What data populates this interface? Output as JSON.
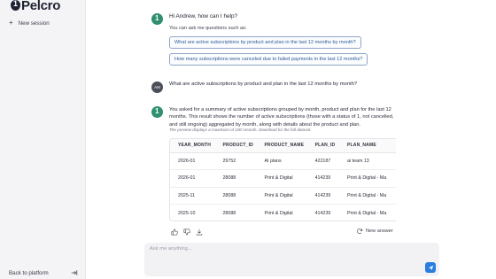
{
  "brand": {
    "name": "Pelcro"
  },
  "sidebar": {
    "new_session_label": "New session",
    "back_label": "Back to platform"
  },
  "chat": {
    "greeting": "Hi Andrew, how can I help?",
    "intro": "You can ask me questions such as:",
    "suggestions": [
      "What are active subscriptions by product and plan in the last 12 months by month?",
      "How many subscriptions were canceled due to failed payments in the last 12 months?"
    ],
    "user_initials": "AM",
    "user_question": "What are active subscriptions by product and plan in the last 12 months by month?",
    "answer": "You asked for a summary of active subscriptions grouped by month, product and plan for the last 12 months. This result shows the number of active subscriptions (those with a status of 1, not cancelled, and still ongoing) aggregated by month, along with details about the product and plan.",
    "preview_note": "The preview displays a maximum of 100 records. Download for the full dataset."
  },
  "table": {
    "headers": [
      "YEAR_MONTH",
      "PRODUCT_ID",
      "PRODUCT_NAME",
      "PLAN_ID",
      "PLAN_NAME"
    ],
    "rows": [
      [
        "2026-01",
        "29752",
        "AI plans",
        "422187",
        "ai team 13"
      ],
      [
        "2026-01",
        "28088",
        "Print & Digital",
        "414239",
        "Print & Digital - Ma"
      ],
      [
        "2025-11",
        "28088",
        "Print & Digital",
        "414239",
        "Print & Digital - Ma"
      ],
      [
        "2025-10",
        "28088",
        "Print & Digital",
        "414239",
        "Print & Digital - Ma"
      ]
    ]
  },
  "actions": {
    "new_answer_label": "New answer"
  },
  "composer": {
    "placeholder": "Ask me anything..."
  },
  "colors": {
    "accent": "#2b7de0",
    "bot_avatar": "#2f8f6f",
    "suggestion_border": "#8fa6c6"
  }
}
